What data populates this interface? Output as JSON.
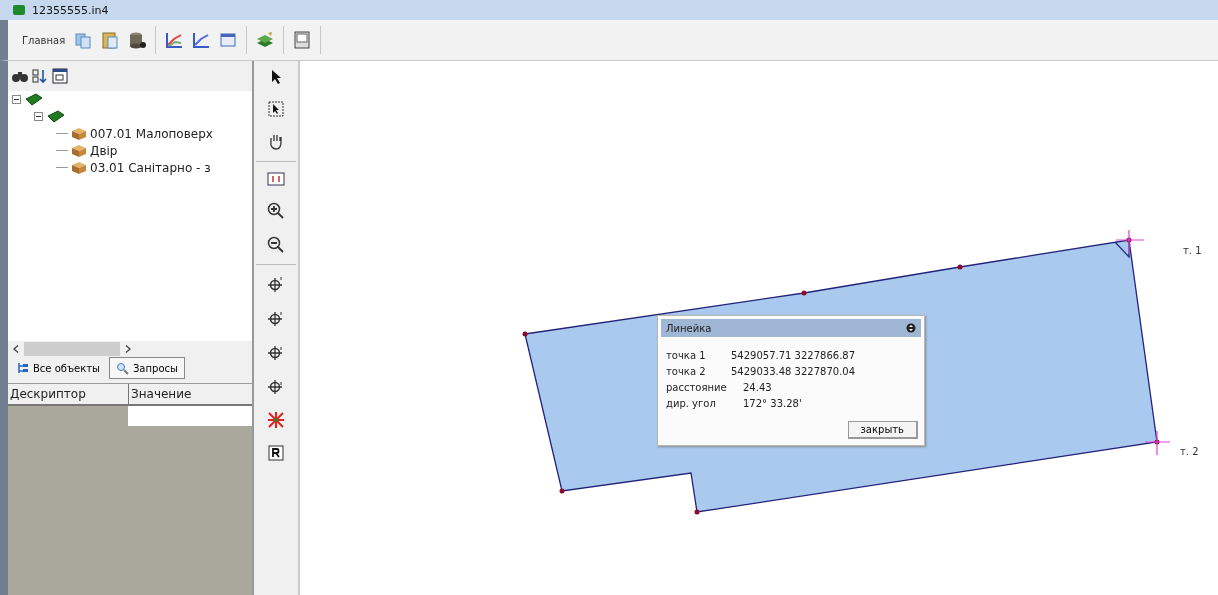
{
  "window": {
    "title": "12355555.in4"
  },
  "toolbar": {
    "label": "Главная"
  },
  "tree": [
    {
      "kind": "layer",
      "expanded": true,
      "children": [
        {
          "kind": "layer",
          "expanded": true,
          "children": [
            {
              "kind": "object",
              "label": "007.01 Малоповерх"
            },
            {
              "kind": "object",
              "label": "Двір"
            },
            {
              "kind": "object",
              "label": "03.01 Санітарно - з"
            }
          ]
        }
      ]
    }
  ],
  "tabs": [
    {
      "label": "Все объекты",
      "selected": true
    },
    {
      "label": "Запросы",
      "selected": false
    }
  ],
  "properties": {
    "columns": [
      "Дескриптор",
      "Значение"
    ]
  },
  "canvas": {
    "point_labels": [
      "т. 1",
      "т. 2"
    ]
  },
  "ruler_dialog": {
    "title": "Линейка",
    "rows": [
      {
        "label": "точка 1",
        "value": "5429057.71 3227866.87"
      },
      {
        "label": "точка 2",
        "value": "5429033.48 3227870.04"
      },
      {
        "label": "расстояние",
        "value": "24.43"
      },
      {
        "label": "дир. угол",
        "value": "172° 33.28'"
      }
    ],
    "button": "закрыть"
  }
}
